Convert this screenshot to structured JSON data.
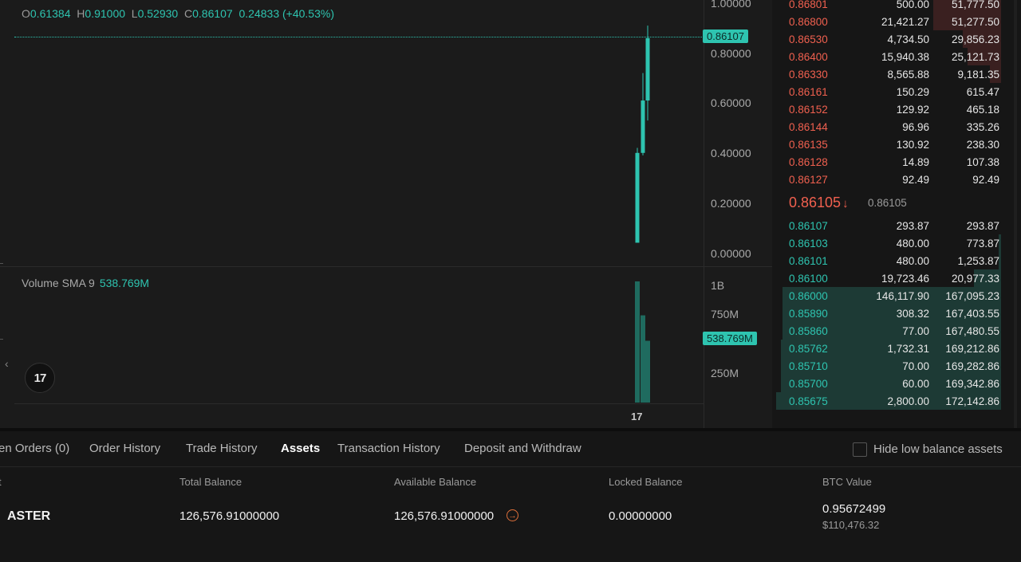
{
  "ohlc": {
    "o_label": "O",
    "o": "0.61384",
    "h_label": "H",
    "h": "0.91000",
    "l_label": "L",
    "l": "0.52930",
    "c_label": "C",
    "c": "0.86107",
    "change": "0.24833 (+40.53%)"
  },
  "price_axis": {
    "ticks": [
      "1.00000",
      "0.80000",
      "0.60000",
      "0.40000",
      "0.20000",
      "0.00000"
    ],
    "last_price_tag": "0.86107"
  },
  "volume": {
    "label": "Volume SMA 9",
    "value": "538.769M",
    "axis_ticks": [
      "1B",
      "750M",
      "250M"
    ],
    "tag": "538.769M"
  },
  "time_axis": {
    "label": "17"
  },
  "colors": {
    "up": "#2ec4b0",
    "down": "#f0604f",
    "accent": "#e0703a"
  },
  "icons": {
    "logo": "tradingview-logo-icon",
    "collapse": "chevron-left-icon",
    "transfer": "arrow-right-circle-icon",
    "mid_arrow": "arrow-down-icon"
  },
  "orderbook": {
    "asks": [
      {
        "price": "0.86801",
        "amount": "500.00",
        "total": "51,777.50",
        "depth": 0.3
      },
      {
        "price": "0.86800",
        "amount": "21,421.27",
        "total": "51,277.50",
        "depth": 0.3
      },
      {
        "price": "0.86530",
        "amount": "4,734.50",
        "total": "29,856.23",
        "depth": 0.17
      },
      {
        "price": "0.86400",
        "amount": "15,940.38",
        "total": "25,121.73",
        "depth": 0.15
      },
      {
        "price": "0.86330",
        "amount": "8,565.88",
        "total": "9,181.35",
        "depth": 0.05
      },
      {
        "price": "0.86161",
        "amount": "150.29",
        "total": "615.47",
        "depth": 0
      },
      {
        "price": "0.86152",
        "amount": "129.92",
        "total": "465.18",
        "depth": 0
      },
      {
        "price": "0.86144",
        "amount": "96.96",
        "total": "335.26",
        "depth": 0
      },
      {
        "price": "0.86135",
        "amount": "130.92",
        "total": "238.30",
        "depth": 0
      },
      {
        "price": "0.86128",
        "amount": "14.89",
        "total": "107.38",
        "depth": 0
      },
      {
        "price": "0.86127",
        "amount": "92.49",
        "total": "92.49",
        "depth": 0
      }
    ],
    "mid_price": "0.86105",
    "mid_arrow": "↓",
    "mark_price": "0.86105",
    "bids": [
      {
        "price": "0.86107",
        "amount": "293.87",
        "total": "293.87",
        "depth": 0
      },
      {
        "price": "0.86103",
        "amount": "480.00",
        "total": "773.87",
        "depth": 0.01
      },
      {
        "price": "0.86101",
        "amount": "480.00",
        "total": "1,253.87",
        "depth": 0.01
      },
      {
        "price": "0.86100",
        "amount": "19,723.46",
        "total": "20,977.33",
        "depth": 0.12
      },
      {
        "price": "0.86000",
        "amount": "146,117.90",
        "total": "167,095.23",
        "depth": 0.97
      },
      {
        "price": "0.85890",
        "amount": "308.32",
        "total": "167,403.55",
        "depth": 0.97
      },
      {
        "price": "0.85860",
        "amount": "77.00",
        "total": "167,480.55",
        "depth": 0.97
      },
      {
        "price": "0.85762",
        "amount": "1,732.31",
        "total": "169,212.86",
        "depth": 0.98
      },
      {
        "price": "0.85710",
        "amount": "70.00",
        "total": "169,282.86",
        "depth": 0.98
      },
      {
        "price": "0.85700",
        "amount": "60.00",
        "total": "169,342.86",
        "depth": 0.98
      },
      {
        "price": "0.85675",
        "amount": "2,800.00",
        "total": "172,142.86",
        "depth": 1.0
      }
    ]
  },
  "tabs": [
    "en Orders (0)",
    "Order History",
    "Trade History",
    "Assets",
    "Transaction History",
    "Deposit and Withdraw"
  ],
  "active_tab": "Assets",
  "hide_low_balance_label": "Hide low balance assets",
  "assets_table": {
    "headers": [
      "t",
      "Total Balance",
      "Available Balance",
      "Locked Balance",
      "BTC Value"
    ],
    "row": {
      "asset": "ASTER",
      "total": "126,576.91000000",
      "available": "126,576.91000000",
      "locked": "0.00000000",
      "btc_value": "0.95672499",
      "usd_value": "$110,476.32"
    }
  },
  "candles": [
    {
      "open": 0.04,
      "high": 0.42,
      "low": 0.04,
      "close": 0.4
    },
    {
      "open": 0.4,
      "high": 0.72,
      "low": 0.39,
      "close": 0.61
    },
    {
      "open": 0.61,
      "high": 0.91,
      "low": 0.53,
      "close": 0.86
    }
  ],
  "volume_bars": [
    1.0,
    0.72,
    0.51
  ]
}
